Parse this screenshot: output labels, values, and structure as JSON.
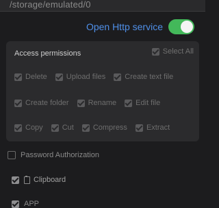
{
  "storage": {
    "path": "/storage/emulated/0"
  },
  "http_service": {
    "label": "Open Http service",
    "enabled": true,
    "switch_color": "#43b85a",
    "label_color": "#4f8fe8"
  },
  "permissions": {
    "title": "Access permissions",
    "select_all": "Select All",
    "rows": [
      [
        "Delete",
        "Upload files",
        "Create text file"
      ],
      [
        "Create folder",
        "Rename",
        "Edit file"
      ],
      [
        "Copy",
        "Cut",
        "Compress",
        "Extract"
      ]
    ]
  },
  "options": {
    "password": {
      "label": "Password Authorization",
      "checked": false
    },
    "clipboard": {
      "label": "Clipboard",
      "checked": true,
      "icon": "clipboard-icon"
    },
    "app": {
      "label": "APP",
      "checked": true
    }
  }
}
